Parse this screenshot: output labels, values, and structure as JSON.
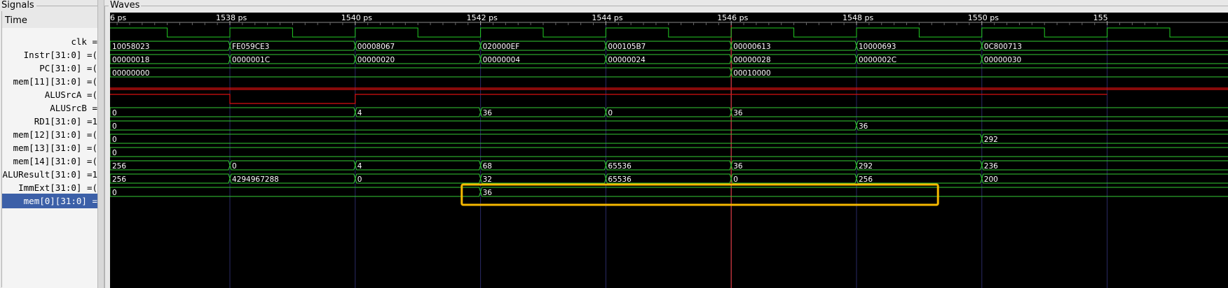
{
  "panels": {
    "signals_title": "Signals",
    "waves_title": "Waves"
  },
  "signals_header": "Time",
  "signals": [
    {
      "name": "clk =",
      "kind": "clock"
    },
    {
      "name": "Instr[31:0] =(",
      "kind": "bus",
      "values": [
        "10058023",
        "FE059CE3",
        "00008067",
        "020000EF",
        "000105B7",
        "00000613",
        "10000693",
        "0C800713"
      ],
      "changes": [
        1536,
        1538,
        1540,
        1542,
        1544,
        1546,
        1548,
        1550
      ]
    },
    {
      "name": "PC[31:0] =(",
      "kind": "bus",
      "values": [
        "00000018",
        "0000001C",
        "00000020",
        "00000004",
        "00000024",
        "00000028",
        "0000002C",
        "00000030"
      ],
      "changes": [
        1536,
        1538,
        1540,
        1542,
        1544,
        1546,
        1548,
        1550
      ]
    },
    {
      "name": "mem[11][31:0] =(",
      "kind": "bus",
      "values": [
        "00000000",
        "00010000"
      ],
      "changes": [
        1536,
        1546
      ]
    },
    {
      "name": "ALUSrcA =(",
      "kind": "redlow"
    },
    {
      "name": "ALUSrcB =",
      "kind": "bit",
      "segments": [
        [
          1536,
          1538,
          1
        ],
        [
          1538,
          1540,
          0
        ],
        [
          1540,
          1552,
          1
        ]
      ]
    },
    {
      "name": "RD1[31:0] =1",
      "kind": "bus",
      "values": [
        "0",
        "4",
        "36",
        "0",
        "36"
      ],
      "changes": [
        1536,
        1540,
        1542,
        1544,
        1546
      ]
    },
    {
      "name": "mem[12][31:0] =(",
      "kind": "bus",
      "values": [
        "0",
        "36"
      ],
      "changes": [
        1536,
        1548
      ]
    },
    {
      "name": "mem[13][31:0] =(",
      "kind": "bus",
      "values": [
        "0",
        "292"
      ],
      "changes": [
        1536,
        1550
      ]
    },
    {
      "name": "mem[14][31:0] =(",
      "kind": "bus",
      "values": [
        "0"
      ],
      "changes": [
        1536
      ]
    },
    {
      "name": "ALUResult[31:0] =1",
      "kind": "bus",
      "values": [
        "256",
        "0",
        "4",
        "68",
        "65536",
        "36",
        "292",
        "236"
      ],
      "changes": [
        1536,
        1538,
        1540,
        1542,
        1544,
        1546,
        1548,
        1550
      ]
    },
    {
      "name": "ImmExt[31:0] =(",
      "kind": "bus",
      "values": [
        "256",
        "4294967288",
        "0",
        "32",
        "65536",
        "0",
        "256",
        "200"
      ],
      "changes": [
        1536,
        1538,
        1540,
        1542,
        1544,
        1546,
        1548,
        1550
      ]
    },
    {
      "name": "mem[0][31:0] =",
      "kind": "bus",
      "values": [
        "0",
        "36"
      ],
      "changes": [
        1536,
        1542
      ],
      "selected": true
    }
  ],
  "timeline": {
    "start_label": "6 ps",
    "labels": [
      {
        "t": 1538,
        "text": "1538 ps"
      },
      {
        "t": 1540,
        "text": "1540 ps"
      },
      {
        "t": 1542,
        "text": "1542 ps"
      },
      {
        "t": 1544,
        "text": "1544 ps"
      },
      {
        "t": 1546,
        "text": "1546 ps"
      },
      {
        "t": 1548,
        "text": "1548 ps"
      },
      {
        "t": 1550,
        "text": "1550 ps"
      },
      {
        "t": 1552,
        "text": "155"
      }
    ],
    "cursor_time": 1546
  },
  "colors": {
    "wave_green": "#22cc22",
    "bus_green": "#33cc33",
    "red": "#d81010",
    "cursor": "#ff4040",
    "grid": "#2a2a66",
    "highlight": "#f5b800",
    "selected_row": "#3c60a8"
  },
  "highlight_annotation": {
    "start_time": 1541.7,
    "end_time": 1549.3,
    "row": "mem[0][31:0]"
  }
}
